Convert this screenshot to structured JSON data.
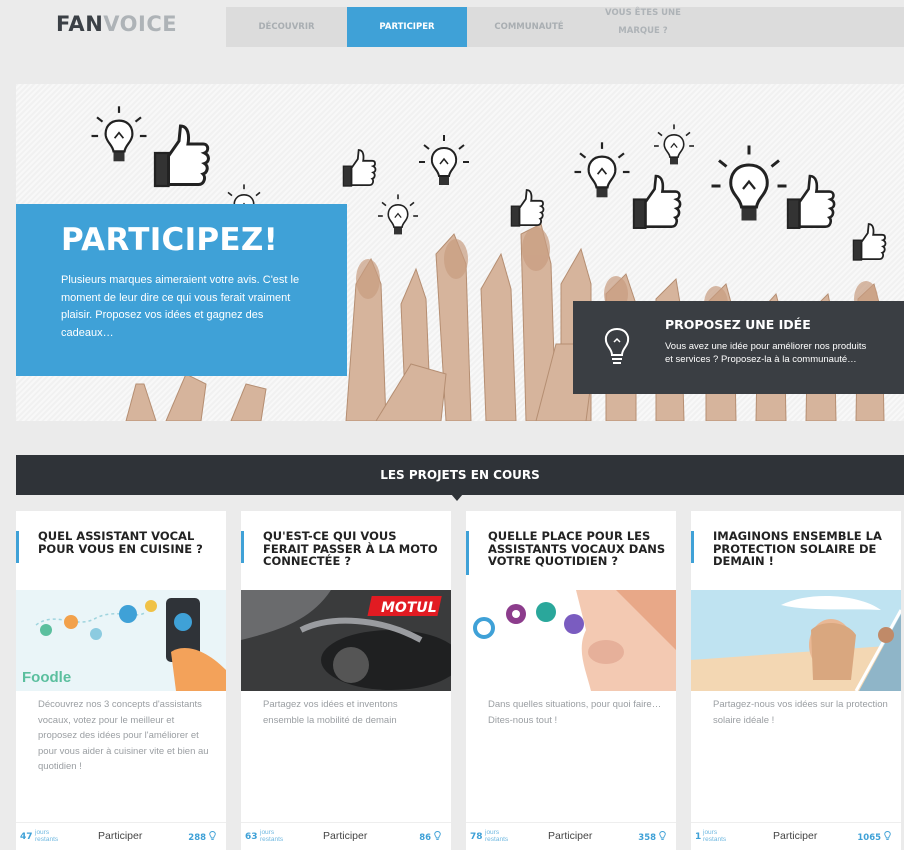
{
  "header": {
    "logo_bold": "FAN",
    "logo_light": "VOICE",
    "nav": [
      {
        "label": "Découvrir"
      },
      {
        "label": "Participer"
      },
      {
        "label": "Communauté"
      }
    ],
    "brand_line1": "Vous êtes une",
    "brand_line2": "marque ?"
  },
  "hero": {
    "title": "PARTICIPEZ!",
    "text": "Plusieurs marques aimeraient votre avis. C'est le moment de leur dire ce qui vous ferait vraiment plaisir. Proposez vos idées et gagnez des cadeaux…",
    "cta_title": "PROPOSEZ UNE IDÉE",
    "cta_text": "Vous avez une idée pour améliorer nos produits et services ? Proposez-la à la communauté…"
  },
  "section": {
    "title": "LES PROJETS EN COURS"
  },
  "projects": [
    {
      "title": "Quel assistant vocal pour vous en cuisine ?",
      "description": "Découvrez nos 3 concepts d'assistants vocaux, votez pour le meilleur et proposez des idées pour l'améliorer et pour vous aider à cuisiner vite et bien au quotidien !",
      "brand": "Foodle",
      "days": "47",
      "votes": "288"
    },
    {
      "title": "Qu'est-ce qui vous ferait passer à la moto connectée ?",
      "description": "Partagez vos idées et inventons ensemble la mobilité de demain",
      "brand": "MOTUL",
      "days": "63",
      "votes": "86"
    },
    {
      "title": "Quelle place pour les assistants vocaux dans votre quotidien ?",
      "description": "Dans quelles situations, pour quoi faire… Dites-nous tout !",
      "days": "78",
      "votes": "358"
    },
    {
      "title": "Imaginons ensemble la protection solaire de demain !",
      "description": "Partagez-nous vos idées sur la protection solaire idéale !",
      "days": "1",
      "votes": "1065"
    }
  ],
  "common": {
    "days_label_1": "jours",
    "days_label_2": "restants",
    "participate": "Participer"
  },
  "colors": {
    "accent": "#3fa1d7",
    "dark": "#2f3338",
    "background": "#ebebeb"
  },
  "icons": [
    "lightbulb-icon",
    "thumbs-up-icon"
  ]
}
